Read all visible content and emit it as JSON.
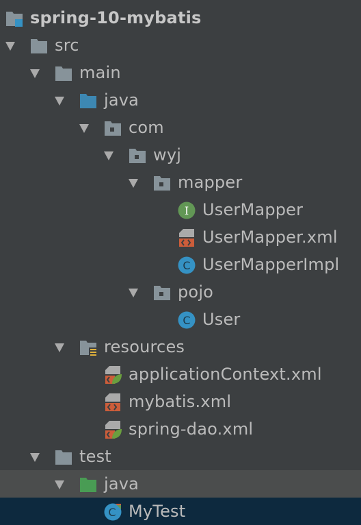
{
  "project": {
    "name": "spring-10-mybatis"
  },
  "tree": [
    {
      "key": "project",
      "label": "spring-10-mybatis",
      "icon": "module-folder-icon",
      "expanded": true
    },
    {
      "key": "src",
      "label": "src",
      "icon": "folder-icon",
      "expanded": true
    },
    {
      "key": "main",
      "label": "main",
      "icon": "folder-icon",
      "expanded": true
    },
    {
      "key": "main-java",
      "label": "java",
      "icon": "source-root-folder-icon",
      "expanded": true
    },
    {
      "key": "com",
      "label": "com",
      "icon": "package-icon",
      "expanded": true
    },
    {
      "key": "wyj",
      "label": "wyj",
      "icon": "package-icon",
      "expanded": true
    },
    {
      "key": "mapper",
      "label": "mapper",
      "icon": "package-icon",
      "expanded": true
    },
    {
      "key": "usermapper",
      "label": "UserMapper",
      "icon": "interface-icon",
      "icon_letter": "I"
    },
    {
      "key": "usermapper-xml",
      "label": "UserMapper.xml",
      "icon": "xml-file-icon"
    },
    {
      "key": "usermapperimpl",
      "label": "UserMapperImpl",
      "icon": "class-icon",
      "icon_letter": "C"
    },
    {
      "key": "pojo",
      "label": "pojo",
      "icon": "package-icon",
      "expanded": true
    },
    {
      "key": "user",
      "label": "User",
      "icon": "class-icon",
      "icon_letter": "C"
    },
    {
      "key": "resources",
      "label": "resources",
      "icon": "resources-folder-icon",
      "expanded": true
    },
    {
      "key": "appctx",
      "label": "applicationContext.xml",
      "icon": "spring-xml-file-icon"
    },
    {
      "key": "mybatis",
      "label": "mybatis.xml",
      "icon": "xml-file-icon"
    },
    {
      "key": "springdao",
      "label": "spring-dao.xml",
      "icon": "spring-xml-file-icon"
    },
    {
      "key": "test",
      "label": "test",
      "icon": "folder-icon",
      "expanded": true
    },
    {
      "key": "test-java",
      "label": "java",
      "icon": "test-root-folder-icon",
      "expanded": true
    },
    {
      "key": "mytest",
      "label": "MyTest",
      "icon": "test-class-icon",
      "icon_letter": "C"
    }
  ],
  "colors": {
    "background": "#3c3f41",
    "text": "#bbbbbb",
    "folder": "#87939a",
    "source_root": "#3d88b3",
    "test_root": "#499c54",
    "interface": "#629755",
    "class": "#3592c4",
    "xml": "#cc5d3a",
    "spring": "#6a9e3f",
    "selection": "#0d293e",
    "hover": "#4b4d4d"
  }
}
